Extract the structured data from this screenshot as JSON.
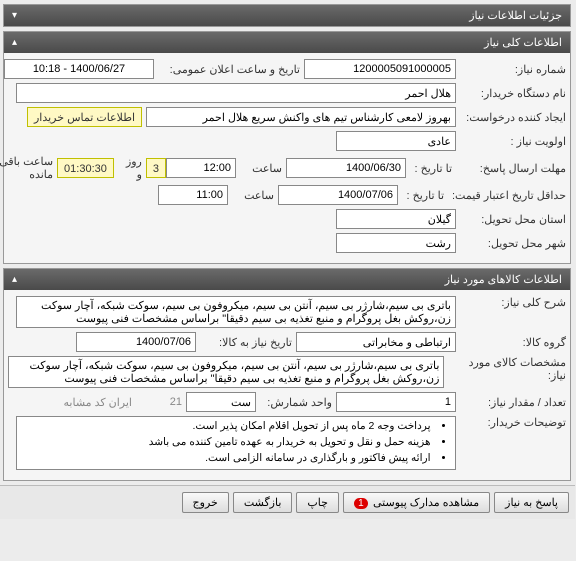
{
  "header": {
    "title": "جزئیات اطلاعات نیاز"
  },
  "need_info": {
    "panel_title": "اطلاعات کلی نیاز",
    "need_no_label": "شماره نیاز:",
    "need_no": "1200005091000005",
    "announce_label": "تاریخ و ساعت اعلان عمومی:",
    "announce_dt": "1400/06/27 - 10:18",
    "buyer_org_label": "نام دستگاه خریدار:",
    "buyer_org": "هلال احمر",
    "creator_label": "ایجاد کننده درخواست:",
    "creator": "بهروز لامعی کارشناس تیم های واکنش سریع هلال احمر",
    "contact_btn": "اطلاعات تماس خریدار",
    "priority_label": "اولویت نیاز :",
    "priority": "عادی",
    "deadline_reply_label": "مهلت ارسال پاسخ:",
    "deadline_reply_to_date_lbl": "تا تاریخ :",
    "deadline_reply_date": "1400/06/30",
    "time_lbl": "ساعت",
    "deadline_reply_time": "12:00",
    "days_count": "3",
    "days_and": "روز و",
    "remaining_time": "01:30:30",
    "remaining_lbl": "ساعت باقی مانده",
    "validity_label": "حداقل تاریخ اعتبار قیمت:",
    "validity_to_date_lbl": "تا تاریخ :",
    "validity_date": "1400/07/06",
    "validity_time": "11:00",
    "province_label": "استان محل تحویل:",
    "province": "گیلان",
    "city_label": "شهر محل تحویل:",
    "city": "رشت"
  },
  "goods": {
    "panel_title": "اطلاعات کالاهای مورد نیاز",
    "desc_label": "شرح کلی نیاز:",
    "desc": "باتری بی سیم،شارژر بی سیم، آنتن بی سیم، میکروفون بی سیم، سوکت شبکه، آچار سوکت زن،روکش بغل پروگرام و منبع تغذیه بی سیم دقیقا\" براساس مشخصات فنی پیوست",
    "group_label": "گروه کالا:",
    "group": "ارتباطی و مخابراتی",
    "need_date_label": "تاریخ نیاز به کالا:",
    "need_date": "1400/07/06",
    "spec_label": "مشخصات کالای مورد نیاز:",
    "spec": "باتری بی سیم،شارژر بی سیم، آنتن بی سیم، میکروفون بی سیم، سوکت شبکه، آچار سوکت زن،روکش بغل پروگرام و منبع تغذیه بی سیم دقیقا\" براساس مشخصات فنی پیوست",
    "qty_label": "تعداد / مقدار نیاز:",
    "qty": "1",
    "unit_label": "واحد شمارش:",
    "unit": "ست",
    "irancode_label": "ایران کد:",
    "irancode": "",
    "item_no_lbl": "21",
    "buyer_notes_label": "توضیحات خریدار:",
    "notes": [
      "پرداخت وجه 2 ماه پس از تحویل اقلام امکان پذیر است.",
      "هزینه حمل و نقل و تحویل به خریدار به عهده تامین کننده می باشد",
      "ارائه پیش فاکتور و بارگذاری در سامانه الزامی است."
    ]
  },
  "buttons": {
    "reply": "پاسخ به نیاز",
    "attachments": "مشاهده مدارک پیوستی",
    "attach_count": "1",
    "print": "چاپ",
    "back": "بازگشت",
    "exit": "خروج"
  }
}
